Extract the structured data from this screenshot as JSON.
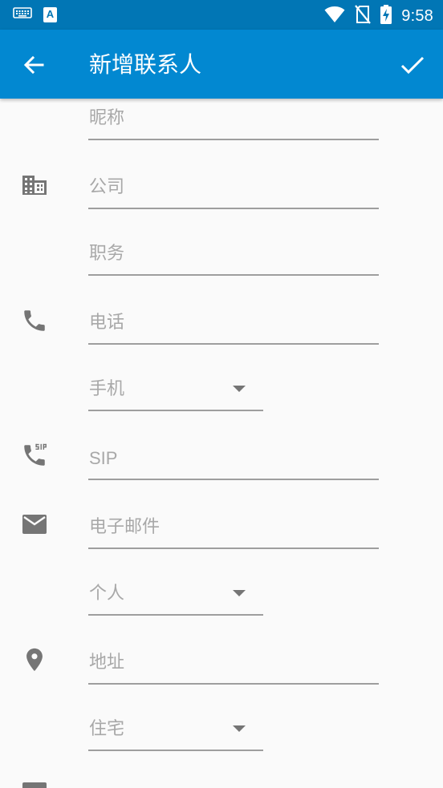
{
  "status_bar": {
    "time": "9:58",
    "icons": [
      "keyboard-icon",
      "text-a-icon",
      "wifi-icon",
      "no-sim-icon",
      "battery-charging-icon"
    ],
    "text_a_glyph": "A"
  },
  "app_bar": {
    "title": "新增联系人",
    "back_icon": "arrow-back-icon",
    "done_icon": "check-icon"
  },
  "fields": {
    "nickname": "昵称",
    "company": "公司",
    "job_title": "职务",
    "phone": "电话",
    "phone_type": "手机",
    "sip": "SIP",
    "email": "电子邮件",
    "email_type": "个人",
    "address": "地址",
    "address_type": "住宅"
  },
  "colors": {
    "status_bar": "#0176b5",
    "app_bar": "#0288d1",
    "background": "#fafafa",
    "icon": "#757575",
    "hint_text": "#a8a8a8",
    "underline": "#9e9e9e"
  }
}
